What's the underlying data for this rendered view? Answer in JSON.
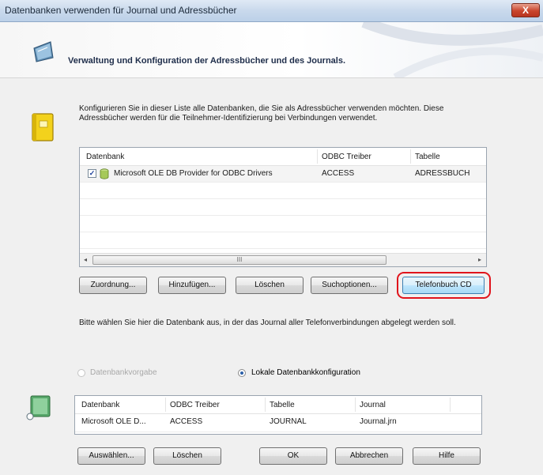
{
  "window": {
    "title": "Datenbanken verwenden für Journal und Adressbücher",
    "close_glyph": "X"
  },
  "banner": {
    "title": "Verwaltung und Konfiguration der Adressbücher und des Journals.",
    "icon": "address-book-icon"
  },
  "addressbooks": {
    "icon": "book-icon",
    "description": "Konfigurieren Sie in dieser Liste alle Datenbanken, die Sie als Adressbücher verwenden möchten. Diese Adressbücher werden für die Teilnehmer-Identifizierung bei Verbindungen verwendet.",
    "columns": [
      "Datenbank",
      "ODBC Treiber",
      "Tabelle"
    ],
    "rows": [
      {
        "checked": true,
        "check_glyph": "✓",
        "datenbank": "Microsoft OLE DB Provider for ODBC Drivers",
        "treiber": "ACCESS",
        "tabelle": "ADRESSBUCH"
      }
    ],
    "scrollbar": {
      "left_arrow": "◂",
      "right_arrow": "▸",
      "thumb_grip": "III"
    }
  },
  "buttons_top": {
    "zuordnung": "Zuordnung...",
    "hinzufuegen": "Hinzufügen...",
    "loeschen": "Löschen",
    "suchoptionen": "Suchoptionen...",
    "telefonbuch": "Telefonbuch CD"
  },
  "journal": {
    "hint": "Bitte wählen Sie hier die Datenbank aus, in der das Journal aller Telefonverbindungen abgelegt werden soll.",
    "radio_default": "Datenbankvorgabe",
    "radio_local": "Lokale Datenbankkonfiguration",
    "selected_option": "Lokale Datenbankkonfiguration",
    "icon": "database-icon",
    "columns": [
      "Datenbank",
      "ODBC Treiber",
      "Tabelle",
      "Journal"
    ],
    "row": {
      "datenbank": "Microsoft OLE D...",
      "treiber": "ACCESS",
      "tabelle": "JOURNAL",
      "journal": "Journal.jrn"
    }
  },
  "buttons_bottom": {
    "auswaehlen": "Auswählen...",
    "loeschen": "Löschen",
    "ok": "OK",
    "abbrechen": "Abbrechen",
    "hilfe": "Hilfe"
  },
  "colors": {
    "highlight_ring": "#e0141c",
    "focus_button": "#3c7fb1",
    "close_button": "#c9452c"
  }
}
